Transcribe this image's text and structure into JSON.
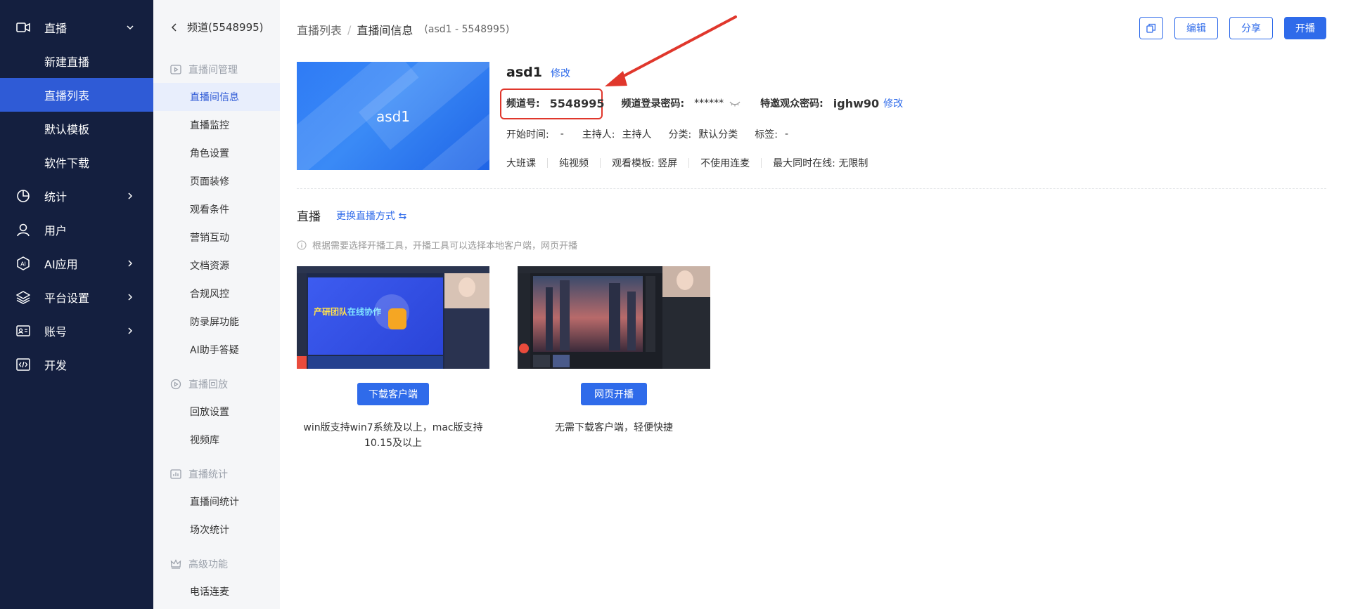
{
  "nav": {
    "items": [
      {
        "label": "直播",
        "icon": "video-camera-icon"
      },
      {
        "label": "统计",
        "icon": "pie-chart-icon"
      },
      {
        "label": "用户",
        "icon": "user-icon"
      },
      {
        "label": "AI应用",
        "icon": "ai-icon"
      },
      {
        "label": "平台设置",
        "icon": "layers-icon"
      },
      {
        "label": "账号",
        "icon": "id-card-icon"
      },
      {
        "label": "开发",
        "icon": "code-icon"
      }
    ],
    "sub": [
      "新建直播",
      "直播列表",
      "默认模板",
      "软件下载"
    ]
  },
  "side": {
    "back_label": "频道(5548995)",
    "groups": [
      {
        "label": "直播间管理",
        "items": [
          "直播间信息",
          "直播监控",
          "角色设置",
          "页面装修",
          "观看条件",
          "营销互动",
          "文档资源",
          "合规风控",
          "防录屏功能",
          "AI助手答疑"
        ]
      },
      {
        "label": "直播回放",
        "items": [
          "回放设置",
          "视频库"
        ]
      },
      {
        "label": "直播统计",
        "items": [
          "直播间统计",
          "场次统计"
        ]
      },
      {
        "label": "高级功能",
        "items": [
          "电话连麦"
        ]
      }
    ]
  },
  "breadcrumb": {
    "root": "直播列表",
    "sep": "/",
    "current": "直播间信息",
    "meta": "(asd1 - 5548995)"
  },
  "toolbar": {
    "edit": "编辑",
    "share": "分享",
    "start": "开播"
  },
  "channel": {
    "cover_text": "asd1",
    "name": "asd1",
    "modify": "修改",
    "id_label": "频道号:",
    "id_value": "5548995",
    "login_pwd_label": "频道登录密码:",
    "login_pwd_value": "******",
    "guest_pwd_label": "特邀观众密码:",
    "guest_pwd_value": "ighw90",
    "guest_modify": "修改",
    "start_time_label": "开始时间:",
    "start_time_value": "-",
    "host_label": "主持人:",
    "host_value": "主持人",
    "category_label": "分类:",
    "category_value": "默认分类",
    "tag_label": "标签:",
    "tag_value": "-",
    "scene": "大班课",
    "mode": "纯视频",
    "template": "观看模板: 竖屏",
    "mic": "不使用连麦",
    "max_online": "最大同时在线: 无限制"
  },
  "live": {
    "title": "直播",
    "switch": "更换直播方式 ⇆",
    "tip": "根据需要选择开播工具，开播工具可以选择本地客户端，网页开播",
    "client_btn": "下载客户端",
    "client_desc_1": "win版支持win7系统及以上，mac版支持",
    "client_desc_2": "10.15及以上",
    "web_btn": "网页开播",
    "web_desc": "无需下载客户端，轻便快捷",
    "preview_slogan_1": "产研团队",
    "preview_slogan_2": "在线协作"
  },
  "colors": {
    "nav_bg": "#141f3f",
    "nav_active": "#2f5bd6",
    "primary": "#2f6bea",
    "highlight": "#e0372c"
  }
}
